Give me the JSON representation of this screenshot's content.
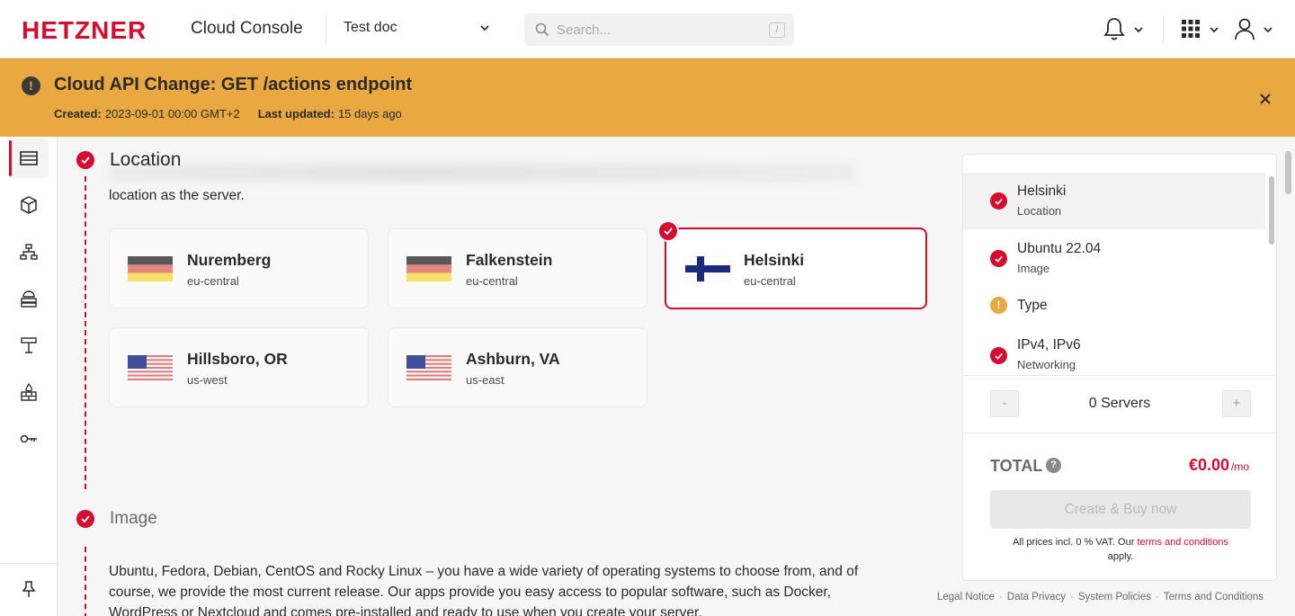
{
  "header": {
    "brand": "HETZNER",
    "app_title": "Cloud Console",
    "project": "Test doc",
    "search_placeholder": "Search...",
    "search_shortcut": "/"
  },
  "banner": {
    "title": "Cloud API Change: GET /actions endpoint",
    "created_label": "Created:",
    "created_value": "2023-09-01 00:00 GMT+2",
    "updated_label": "Last updated:",
    "updated_value": "15 days ago"
  },
  "location_section": {
    "title": "Location",
    "description_tail": "location as the server.",
    "locations": [
      {
        "name": "Nuremberg",
        "zone": "eu-central",
        "flag": "germany-flag",
        "selected": false
      },
      {
        "name": "Falkenstein",
        "zone": "eu-central",
        "flag": "germany-flag",
        "selected": false
      },
      {
        "name": "Helsinki",
        "zone": "eu-central",
        "flag": "finland-flag",
        "selected": true
      },
      {
        "name": "Hillsboro, OR",
        "zone": "us-west",
        "flag": "usa-flag",
        "selected": false
      },
      {
        "name": "Ashburn, VA",
        "zone": "us-east",
        "flag": "usa-flag",
        "selected": false
      }
    ]
  },
  "image_section": {
    "title": "Image",
    "description_line1": "Ubuntu, Fedora, Debian, CentOS and Rocky Linux – you have a wide variety of operating systems to choose from, and of",
    "description_line2": "course, we provide the most current release. Our apps provide you easy access to popular software, such as Docker,",
    "description_line3": "WordPress or Nextcloud and comes pre-installed and ready to use when you create your server."
  },
  "summary": {
    "items": [
      {
        "title": "Helsinki",
        "subtitle": "Location",
        "status": "ok"
      },
      {
        "title": "Ubuntu 22.04",
        "subtitle": "Image",
        "status": "ok"
      },
      {
        "title": "Type",
        "subtitle": "",
        "status": "warning"
      },
      {
        "title": "IPv4, IPv6",
        "subtitle": "Networking",
        "status": "ok"
      }
    ],
    "decrement_label": "-",
    "increment_label": "+",
    "quantity_label": "0 Servers",
    "total_label": "TOTAL",
    "help_label": "?",
    "price": "€0.00",
    "price_period": "/mo",
    "buy_button": "Create & Buy now",
    "vat_text": "All prices incl. 0 % VAT. Our",
    "terms_link": "terms and conditions",
    "vat_suffix": "apply."
  },
  "footer": {
    "links": [
      "Legal Notice",
      "Data Privacy",
      "System Policies",
      "Terms and Conditions"
    ]
  },
  "sidebar": {
    "items": [
      "servers-icon",
      "volumes-icon",
      "networks-icon",
      "load-balancers-icon",
      "floating-ip-icon",
      "firewalls-icon",
      "security-keys-icon"
    ],
    "pin": "pin-icon"
  },
  "colors": {
    "brand_red": "#d50c2d",
    "banner_orange": "#eaa840",
    "warning": "#eaa840"
  }
}
